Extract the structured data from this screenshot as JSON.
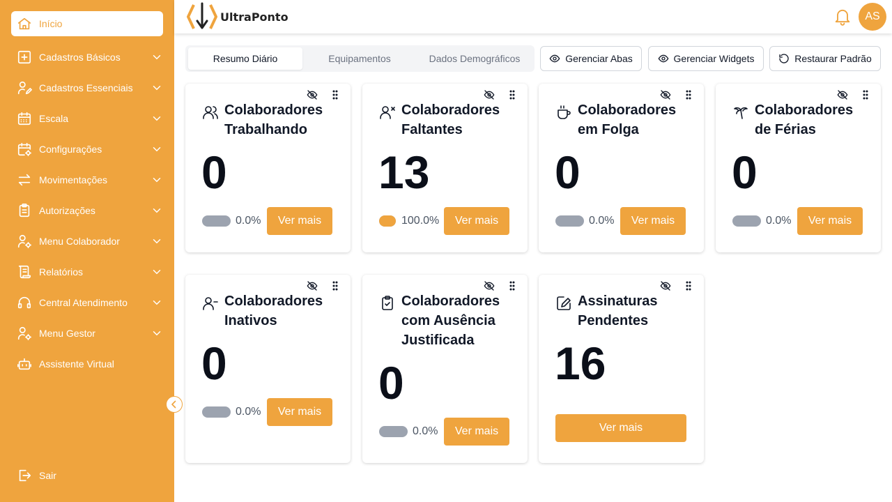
{
  "brand": {
    "name": "UltraPonto",
    "accent": "#EFA43E"
  },
  "user": {
    "initials": "AS"
  },
  "sidebar": {
    "items": [
      {
        "label": "Início",
        "icon": "home-icon",
        "active": true
      },
      {
        "label": "Cadastros Básicos",
        "icon": "plus-square-icon"
      },
      {
        "label": "Cadastros Essenciais",
        "icon": "user-edit-icon"
      },
      {
        "label": "Escala",
        "icon": "calendar-icon"
      },
      {
        "label": "Configurações",
        "icon": "calendar-gear-icon"
      },
      {
        "label": "Movimentações",
        "icon": "arrows-exchange-icon"
      },
      {
        "label": "Autorizações",
        "icon": "clipboard-list-icon"
      },
      {
        "label": "Menu Colaborador",
        "icon": "user-gear-icon"
      },
      {
        "label": "Relatórios",
        "icon": "scroll-icon"
      },
      {
        "label": "Central Atendimento",
        "icon": "headset-icon"
      },
      {
        "label": "Menu Gestor",
        "icon": "user-gear-icon"
      },
      {
        "label": "Assistente Virtual",
        "icon": "robot-icon"
      }
    ],
    "logout": {
      "label": "Sair",
      "icon": "logout-icon"
    }
  },
  "tabs": [
    {
      "label": "Resumo Diário",
      "active": true
    },
    {
      "label": "Equipamentos"
    },
    {
      "label": "Dados Demográficos"
    }
  ],
  "toolbar": {
    "manage_tabs": "Gerenciar Abas",
    "manage_widgets": "Gerenciar Widgets",
    "restore_default": "Restaurar Padrão"
  },
  "cards": [
    {
      "title": "Colaboradores Trabalhando",
      "value": "0",
      "percent": "0.0%",
      "fill": 0,
      "button": "Ver mais",
      "icon": "users-icon"
    },
    {
      "title": "Colaboradores Faltantes",
      "value": "13",
      "percent": "100.0%",
      "fill": 1,
      "button": "Ver mais",
      "icon": "user-x-icon"
    },
    {
      "title": "Colaboradores em Folga",
      "value": "0",
      "percent": "0.0%",
      "fill": 0,
      "button": "Ver mais",
      "icon": "coffee-icon"
    },
    {
      "title": "Colaboradores de Férias",
      "value": "0",
      "percent": "0.0%",
      "fill": 0,
      "button": "Ver mais",
      "icon": "palm-tree-icon"
    },
    {
      "title": "Colaboradores Inativos",
      "value": "0",
      "percent": "0.0%",
      "fill": 0,
      "button": "Ver mais",
      "icon": "user-minus-icon"
    },
    {
      "title": "Colaboradores com Ausência Justificada",
      "value": "0",
      "percent": "0.0%",
      "fill": 0,
      "button": "Ver mais",
      "icon": "clipboard-check-icon"
    },
    {
      "title": "Assinaturas Pendentes",
      "value": "16",
      "button": "Ver mais",
      "icon": "signature-icon"
    }
  ]
}
